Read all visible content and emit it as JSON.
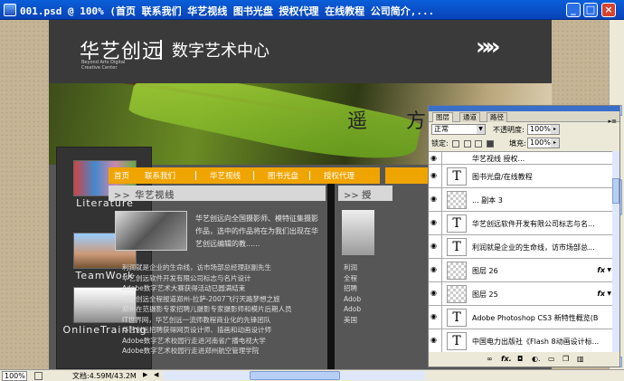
{
  "window": {
    "title": "001.psd @ 100% (首页                    联系我们      华艺视线      图书光盘      授权代理      在线教程      公司简介,...",
    "min": "_",
    "max": "□",
    "close": "×"
  },
  "page": {
    "logo": "华艺创远",
    "logo_sub": "Beyond Arts Digital Creative Center",
    "center_title": "数字艺术中心",
    "arrow": "»»",
    "banner_text": "遥 方",
    "sidebar": [
      {
        "label": "Literature"
      },
      {
        "label": "TeamWork"
      },
      {
        "label": "OnlineTraining"
      }
    ],
    "nav": [
      "首页",
      "联系我们",
      "华艺视线",
      "图书光盘",
      "授权代理"
    ],
    "section_title": ">> 华艺视线",
    "section_title_2": ">> 授",
    "intro": "华艺创远向全国摄影师、模特征集摄影作品，选中的作品将在为我们出现在华艺创远编辑的教......",
    "news": [
      "利润就是企业的生命线，访市场部总经理赵副先生",
      "华艺创远软件开发有限公司标志与名片设计",
      "Adobe数字艺术大赛获得活动已圆满结束",
      "华艺创远全程报道郑州-拉萨-2007飞行天路梦想之旅",
      "郑州在范摄影专家招聘儿摄影专家摄影师和模片后期人员",
      "IT世界网，华艺创远一流师教程商业化的先锋团队",
      "华艺创远招聘获得网页设计师、插画和动画设计师",
      "Adobe数字艺术校园行走进河南省广播电视大学",
      "Adobe数字艺术校园行走进郑州航空管理学院"
    ],
    "news2": [
      "利润",
      "全程",
      "招聘",
      "Adob",
      "Adob",
      "美国"
    ]
  },
  "status": {
    "zoom": "100%",
    "doc": "文档:4.59M/43.2M"
  },
  "layers_panel": {
    "tabs": [
      "图层",
      "通道",
      "路径"
    ],
    "blend_mode": "正常",
    "opacity_label": "不透明度:",
    "opacity": "100%",
    "lock_label": "锁定:",
    "fill_label": "填充:",
    "fill": "100%",
    "layers": [
      {
        "name": "华艺视线                  授权...",
        "thumb": "T"
      },
      {
        "name": "图书光盘/在线教程",
        "thumb": "T"
      },
      {
        "name": "... 副本 3",
        "thumb": "check"
      },
      {
        "name": "华艺创远软件开发有限公司标志与名...",
        "thumb": "T"
      },
      {
        "name": "利润就是企业的生命线，访市场部总...",
        "thumb": "T"
      },
      {
        "name": "图层 26",
        "thumb": "check",
        "fx": "fx"
      },
      {
        "name": "图层 25",
        "thumb": "check",
        "fx": "fx"
      },
      {
        "name": "Adobe Photoshop CS3 新特性概览(Beta",
        "thumb": "T"
      },
      {
        "name": "中国电力出版社《Flash 8动画设计标...",
        "thumb": "T"
      }
    ],
    "footer_icons": [
      "link-icon",
      "fx-icon",
      "mask-icon",
      "adjust-icon",
      "folder-icon",
      "new-layer-icon",
      "trash-icon"
    ]
  },
  "colors": {
    "accent": "#f0a400",
    "titlebar": "#0a5fd8",
    "doc_bg": "#565656"
  }
}
